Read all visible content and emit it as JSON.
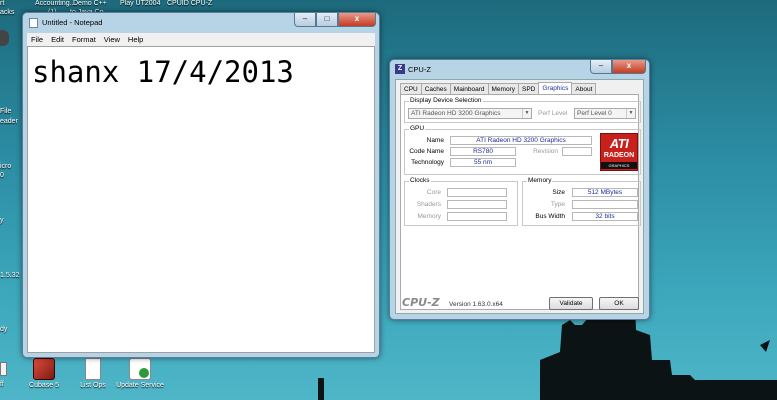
{
  "desktop": {
    "top_labels": [
      "rt",
      "Accounting...",
      "Demo C++",
      "Play UT2004",
      "CPUID CPU-Z"
    ],
    "top_sublabels": [
      "acks",
      "(1)",
      "to Java Co..."
    ],
    "left_labels": [
      "File",
      "eader",
      "icro",
      "0",
      "y",
      "1.5.32",
      "dy",
      "ff"
    ],
    "bottom_icons": [
      {
        "label": "Cubase 5",
        "icon": "cubase-icon"
      },
      {
        "label": "List Ops",
        "icon": "document-icon"
      },
      {
        "label": "Update Service",
        "icon": "update-icon"
      }
    ]
  },
  "notepad": {
    "title": "Untitled - Notepad",
    "menu": [
      "File",
      "Edit",
      "Format",
      "View",
      "Help"
    ],
    "content": "shanx 17/4/2013",
    "buttons": {
      "minimize": "–",
      "maximize": "□",
      "close": "x"
    }
  },
  "cpuz": {
    "title": "CPU-Z",
    "app_icon_letter": "Z",
    "tabs": [
      "CPU",
      "Caches",
      "Mainboard",
      "Memory",
      "SPD",
      "Graphics",
      "About"
    ],
    "active_tab": "Graphics",
    "display_selection": {
      "title": "Display Device Selection",
      "device": "ATI Radeon HD 3200 Graphics",
      "perf_label": "Perf Level",
      "perf_value": "Perf Level 0"
    },
    "gpu": {
      "title": "GPU",
      "name_label": "Name",
      "name": "ATI Radeon HD 3200 Graphics",
      "codename_label": "Code Name",
      "codename": "RS780",
      "revision_label": "Revision",
      "revision": "",
      "technology_label": "Technology",
      "technology": "55 nm",
      "logo": {
        "ati": "ATI",
        "radeon": "RADEON",
        "graphics": "GRAPHICS"
      }
    },
    "clocks": {
      "title": "Clocks",
      "core_label": "Core",
      "core": "",
      "shaders_label": "Shaders",
      "shaders": "",
      "memory_label": "Memory",
      "memory": ""
    },
    "memory": {
      "title": "Memory",
      "size_label": "Size",
      "size": "512 MBytes",
      "type_label": "Type",
      "type": "",
      "bus_label": "Bus Width",
      "bus": "32 bits"
    },
    "footer": {
      "brand": "CPU-Z",
      "version": "Version 1.63.0.x64",
      "validate": "Validate",
      "ok": "OK"
    },
    "buttons": {
      "minimize": "–",
      "close": "x"
    }
  },
  "colors": {
    "accent": "#2030a0",
    "ati_red": "#c8201c",
    "close_red": "#c43b22"
  }
}
